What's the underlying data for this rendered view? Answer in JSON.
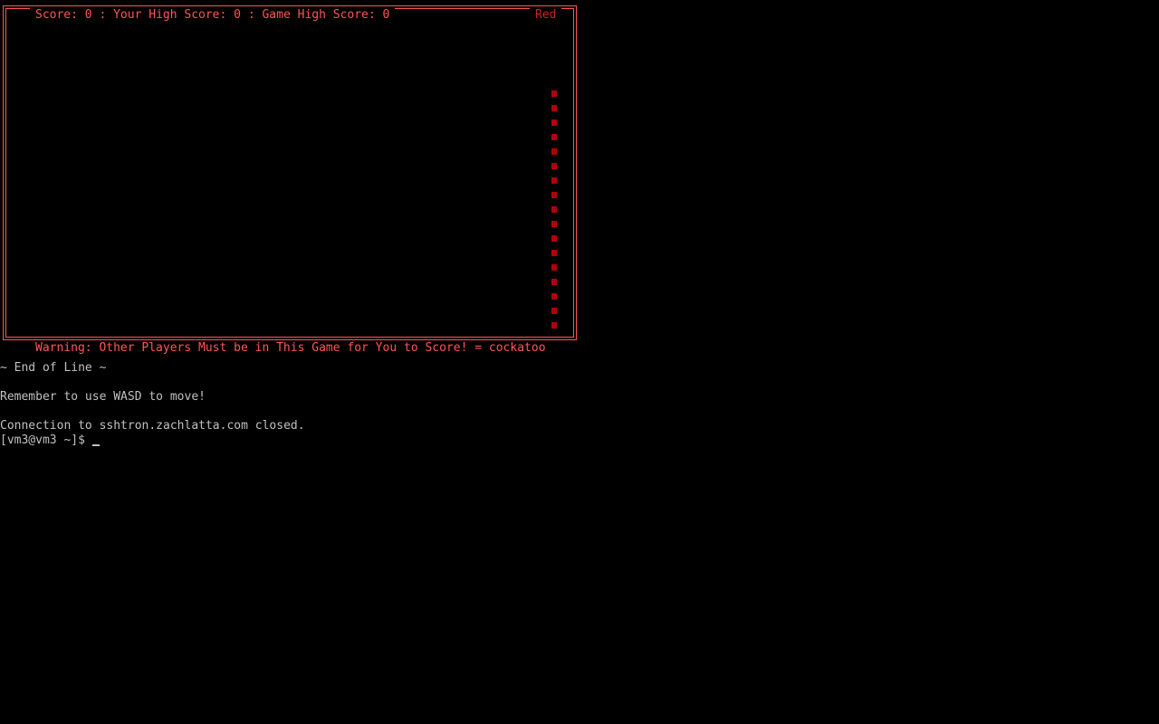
{
  "game": {
    "score_label": "Score: 0",
    "sep1": " : ",
    "your_high_score_label": "Your High Score: 0",
    "sep2": " : ",
    "game_high_score_label": "Game High Score: 0",
    "player_color": "Red",
    "warning": "Warning: Other Players Must be in This Game for You to Score! = cockatoo",
    "trail_color": "#b0000c",
    "border_color": "#ff5555"
  },
  "terminal": {
    "end_of_line": "~ End of Line ~",
    "reminder": "Remember to use WASD to move!",
    "connection_closed": "Connection to sshtron.zachlatta.com closed.",
    "prompt": "[vm3@vm3 ~]$ "
  }
}
